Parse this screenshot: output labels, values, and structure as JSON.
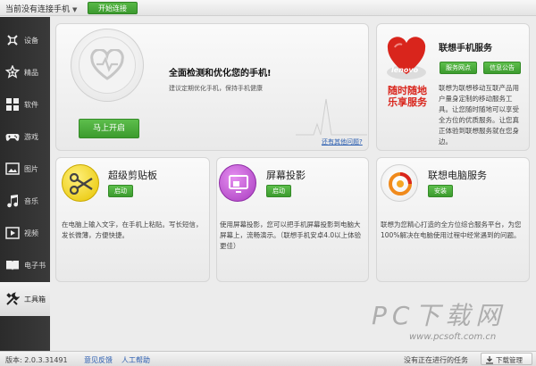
{
  "topbar": {
    "device_label": "当前没有连接手机",
    "connect_button": "开始连接"
  },
  "sidebar": {
    "items": [
      {
        "label": "设备",
        "icon": "device-icon"
      },
      {
        "label": "精品",
        "icon": "star-icon"
      },
      {
        "label": "软件",
        "icon": "apps-grid-icon"
      },
      {
        "label": "游戏",
        "icon": "gamepad-icon"
      },
      {
        "label": "图片",
        "icon": "picture-icon"
      },
      {
        "label": "音乐",
        "icon": "music-note-icon"
      },
      {
        "label": "视频",
        "icon": "video-icon"
      },
      {
        "label": "电子书",
        "icon": "book-icon"
      },
      {
        "label": "工具箱",
        "icon": "tools-icon",
        "active": true
      }
    ]
  },
  "health": {
    "title": "全面检测和优化您的手机!",
    "subtitle": "建议定期优化手机，保持手机健康",
    "start_button": "马上开启",
    "more_link": "还有其他问题?"
  },
  "lenovo_service": {
    "logo_text": "lenovo",
    "title": "联想手机服务",
    "slogan_line1": "随时随地",
    "slogan_line2": "乐享服务",
    "btn_outlets": "服务网点",
    "btn_notice": "信息公告",
    "description": "联想为联想移动互联产品用户量身定制的移动服务工具。让您随时随地可以享受全方位的优质服务。让您真正体验到联想服务就在您身边。"
  },
  "clipboard": {
    "title": "超级剪贴板",
    "button": "启动",
    "description": "在电脑上输入文字，在手机上粘贴。写长短信，发长微薄，方便快捷。"
  },
  "projection": {
    "title": "屏幕投影",
    "button": "启动",
    "description": "使用屏幕投影，您可以把手机屏幕投影到电脑大屏幕上，流畅演示。（联想手机安卓4.0以上体验更佳）"
  },
  "pc_service": {
    "title": "联想电脑服务",
    "button": "安装",
    "description": "联想为您精心打造的全方位综合服务平台，为您100%解决在电脑使用过程中经常遇到的问题。"
  },
  "bottombar": {
    "version": "版本: 2.0.3.31491",
    "feedback": "意见反馈",
    "help": "人工帮助",
    "tasks": "没有正在进行的任务",
    "download_manager": "下载管理"
  },
  "watermark": {
    "main": "PC下载网",
    "url": "www.pcsoft.com.cn"
  },
  "colors": {
    "accent_green": "#47a83a",
    "sidebar_bg": "#333333",
    "lenovo_red": "#d9251c"
  }
}
